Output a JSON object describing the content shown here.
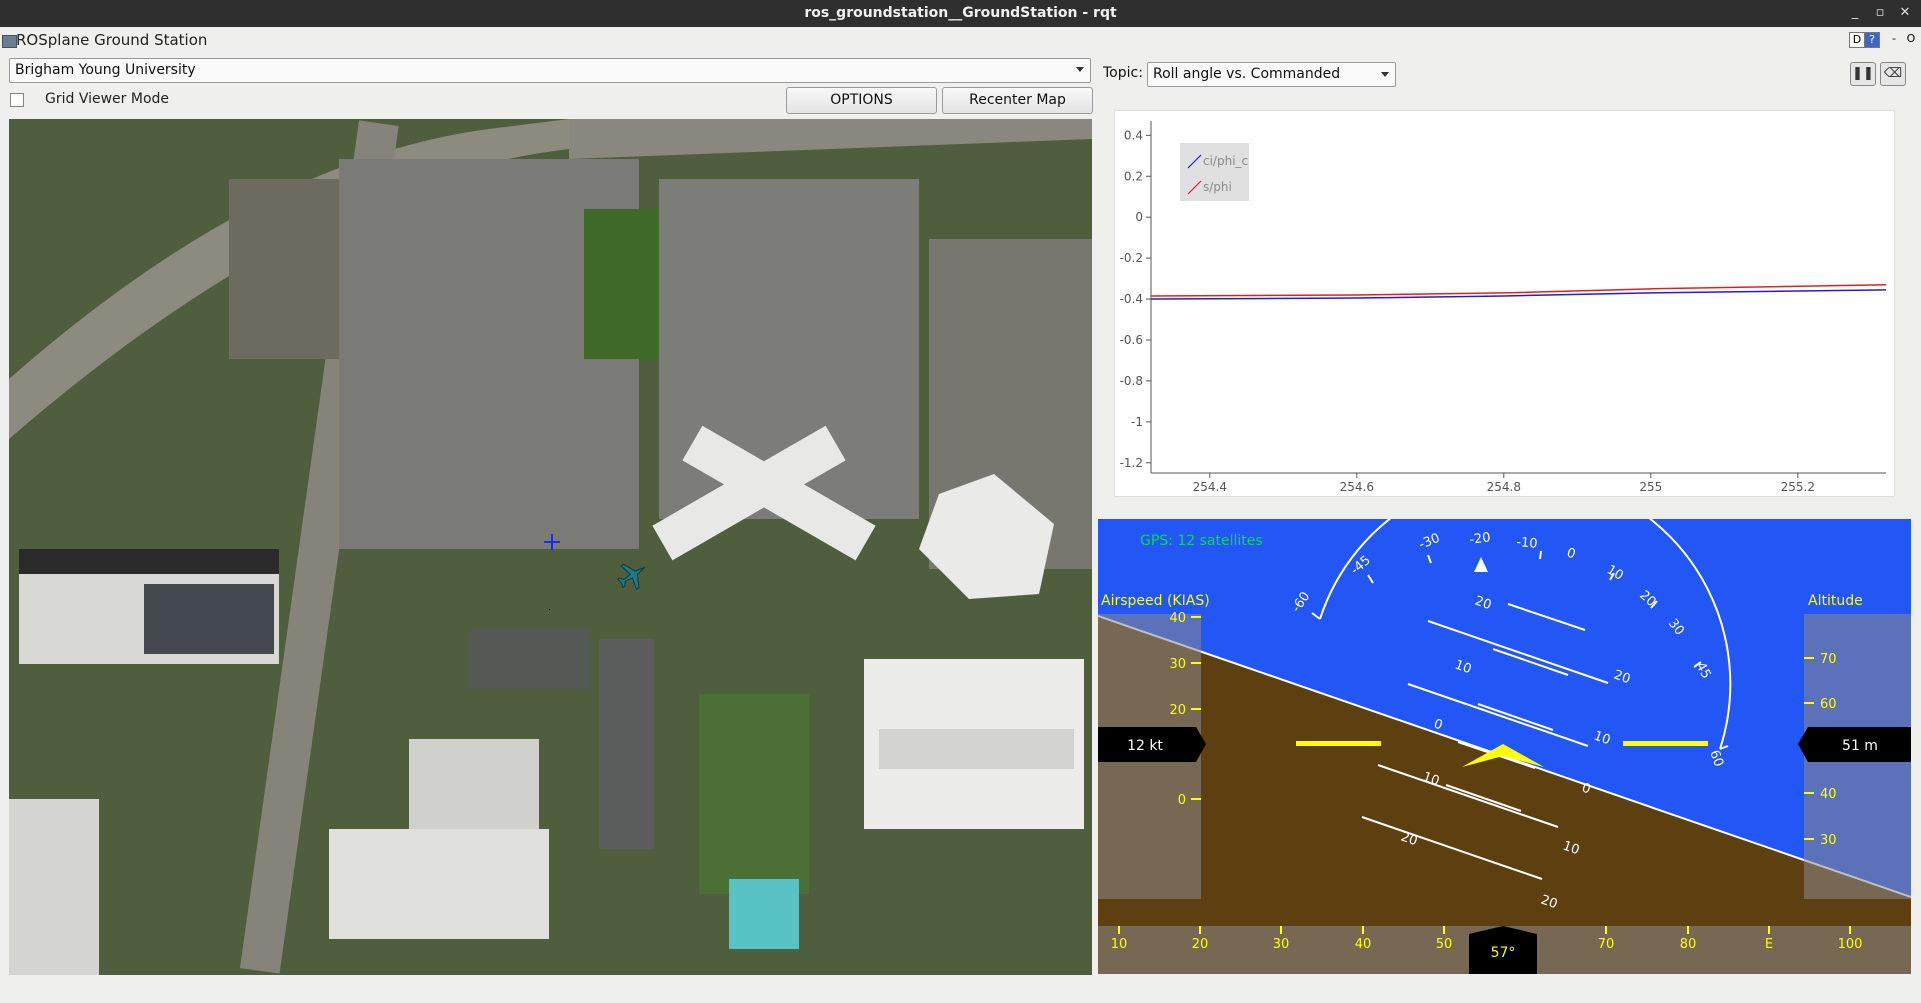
{
  "window": {
    "title": "ros_groundstation__GroundStation - rqt",
    "controls": [
      "_",
      "▫",
      "✕"
    ]
  },
  "app": {
    "title": "ROSplane Ground Station",
    "d_button": "D",
    "help_button": "?",
    "minus_button": "-",
    "o_button": "O"
  },
  "map_panel": {
    "location_selected": "Brigham Young University",
    "grid_viewer_label": "Grid Viewer Mode",
    "grid_viewer_checked": false,
    "options_label": "OPTIONS",
    "recenter_label": "Recenter Map"
  },
  "plot_panel": {
    "topic_label": "Topic:",
    "topic_selected": "Roll angle vs. Commanded",
    "pause_icon": "pause-icon",
    "clear_icon": "clear-icon"
  },
  "chart_data": {
    "type": "line",
    "title": "",
    "xlabel": "",
    "ylabel": "",
    "xlim": [
      254.32,
      255.32
    ],
    "ylim": [
      -1.25,
      0.47
    ],
    "x_ticks": [
      "254.4",
      "254.6",
      "254.8",
      "255",
      "255.2"
    ],
    "y_ticks": [
      "0.4",
      "0.2",
      "0",
      "-0.2",
      "-0.4",
      "-0.6",
      "-0.8",
      "-1",
      "-1.2"
    ],
    "legend_position": "top-left",
    "series": [
      {
        "name": "ci/phi_c",
        "color": "#1f1fd0",
        "x": [
          254.32,
          254.6,
          254.8,
          255.0,
          255.32
        ],
        "y": [
          -0.4,
          -0.395,
          -0.385,
          -0.37,
          -0.355
        ]
      },
      {
        "name": "s/phi",
        "color": "#e02020",
        "x": [
          254.32,
          254.6,
          254.8,
          255.0,
          255.32
        ],
        "y": [
          -0.385,
          -0.38,
          -0.37,
          -0.35,
          -0.33
        ]
      }
    ]
  },
  "hud": {
    "colors": {
      "sky": "#2256f5",
      "ground": "#5e3f10",
      "symbol": "#ffff00",
      "text": "#ffffff",
      "gps": "#00e040"
    },
    "gps_text": "GPS: 12 satellites",
    "airspeed_title": "Airspeed (KIAS)",
    "airspeed_value": "12 kt",
    "airspeed_ticks": [
      "40",
      "30",
      "20",
      "0"
    ],
    "altitude_title": "Altitude",
    "altitude_value": "51 m",
    "altitude_ticks": [
      "70",
      "60",
      "40",
      "30"
    ],
    "roll_labels": [
      "-60",
      "-45",
      "-30",
      "-20",
      "-10",
      "0",
      "10",
      "20",
      "30",
      "45",
      "60"
    ],
    "pitch_labels": [
      "20",
      "10",
      "0",
      "10",
      "20"
    ],
    "pitch_labels_right": [
      "20",
      "10",
      "0",
      "10",
      "20"
    ],
    "heading_ticks": [
      "10",
      "20",
      "30",
      "40",
      "50",
      "70",
      "80",
      "E",
      "100"
    ],
    "heading_value": "57°"
  }
}
